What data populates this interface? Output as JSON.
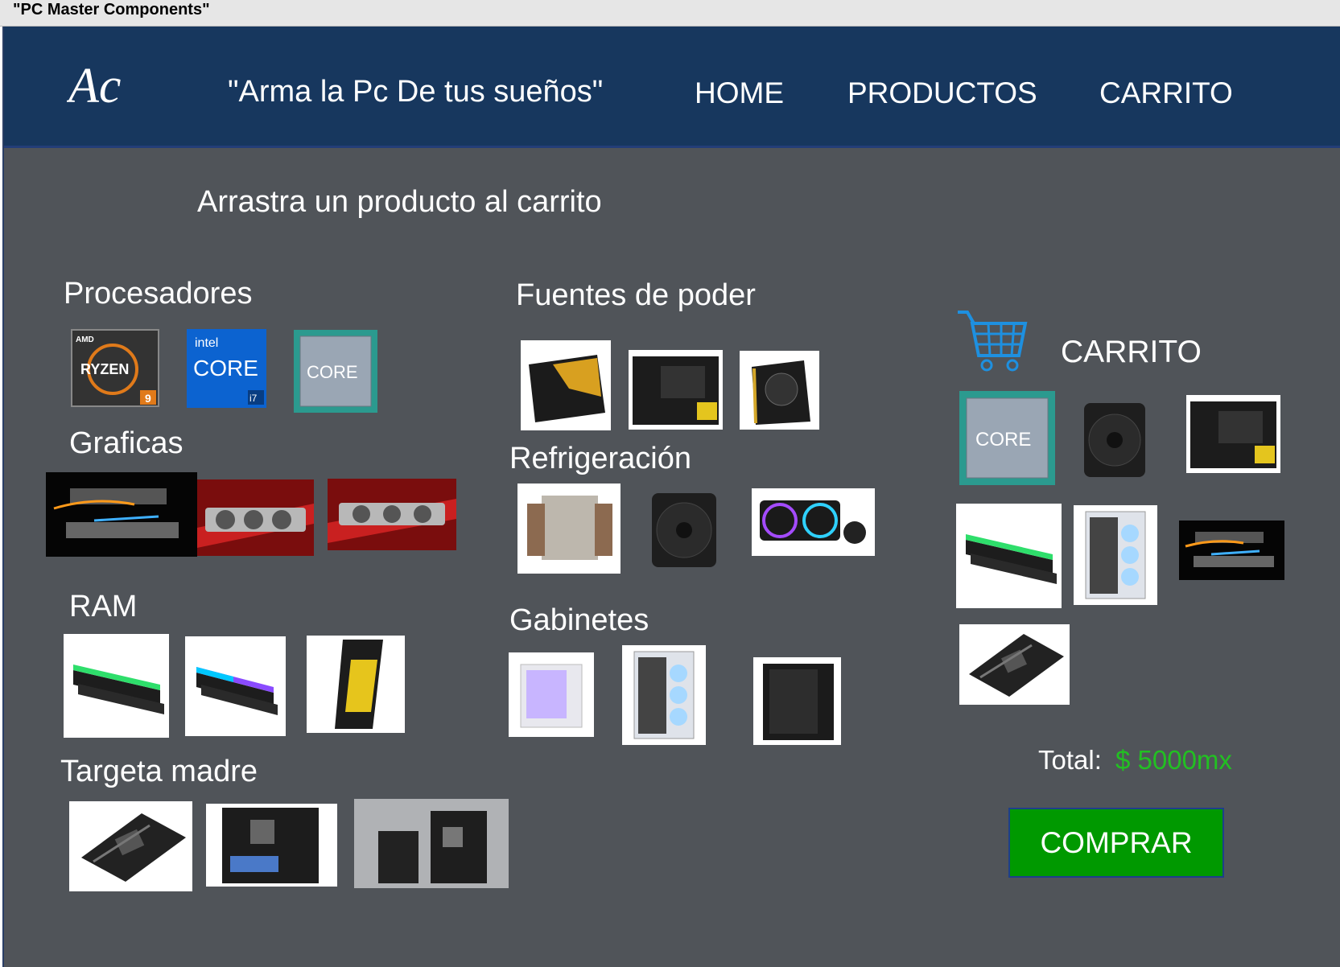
{
  "window": {
    "title": "\"PC Master Components\""
  },
  "header": {
    "logo_text": "Ac",
    "slogan": "\"Arma la Pc De tus sueños\"",
    "nav": {
      "home": "HOME",
      "productos": "PRODUCTOS",
      "carrito": "CARRITO"
    }
  },
  "main": {
    "instruction": "Arrastra un producto al carrito",
    "sections": {
      "procesadores": "Procesadores",
      "graficas": "Graficas",
      "ram": "RAM",
      "targeta_madre": "Targeta madre",
      "fuentes": "Fuentes de poder",
      "refrigeracion": "Refrigeración",
      "gabinetes": "Gabinetes"
    },
    "product_images": {
      "amd_brand": "AMD",
      "ryzen": "RYZEN",
      "ryzen_tier": "9",
      "intel_brand": "intel",
      "core": "CORE",
      "i7": "i7"
    }
  },
  "cart": {
    "title": "CARRITO",
    "total_label": "Total:",
    "total_value": "$ 5000mx",
    "buy_label": "COMPRAR"
  },
  "colors": {
    "navbar": "#17375e",
    "background": "#505459",
    "buy_button": "#009900",
    "total_value": "#22c022",
    "cart_icon": "#1e90e0"
  }
}
